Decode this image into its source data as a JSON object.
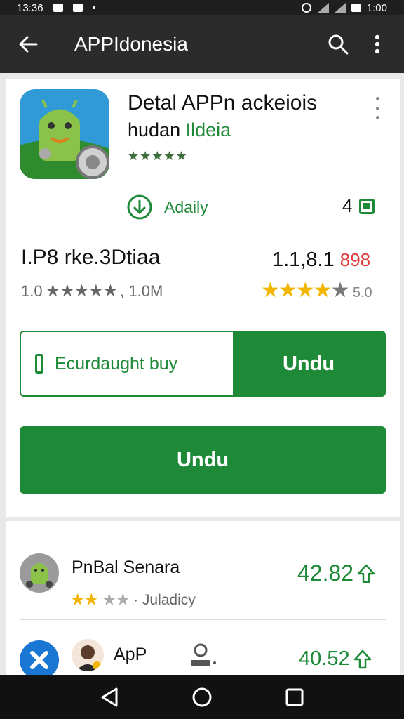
{
  "status_bar": {
    "time": "13:36",
    "battery_text": "1:00"
  },
  "app_bar": {
    "title": "APPIdonesia",
    "icons": [
      "back-arrow-icon",
      "search-icon",
      "more-vert-icon"
    ]
  },
  "detail": {
    "title": "Detal APPn ackeiois",
    "subtitle_plain": "hudan",
    "subtitle_green": "Ildeia",
    "stars_text": "★★★★★",
    "install_label": "Adaily",
    "badge_count": "4"
  },
  "stats": {
    "name": "I.P8 rke.3Dtiaa",
    "version": "1.1,8.1",
    "version_red": "898",
    "rating_prefix": "1.0",
    "rating_stars": "★★★★★",
    "download_count": ", 1.0M",
    "stars_on": "★★★★",
    "stars_off": "★",
    "stars_label": "5.0"
  },
  "buttons": {
    "split_left_label": "Ecurdaught buy",
    "split_right_label": "Undu",
    "primary_label": "Undu"
  },
  "list": [
    {
      "title": "PnBal Senara",
      "stars_on": "★★",
      "stars_off": "★★",
      "sub": "· Juladicy",
      "price": "42.82"
    },
    {
      "title": "ApP",
      "price": "40.52"
    }
  ],
  "colors": {
    "accent": "#1e8a38",
    "star": "#f2b600",
    "appbar": "#2b2b2b",
    "navbar": "#111111"
  }
}
